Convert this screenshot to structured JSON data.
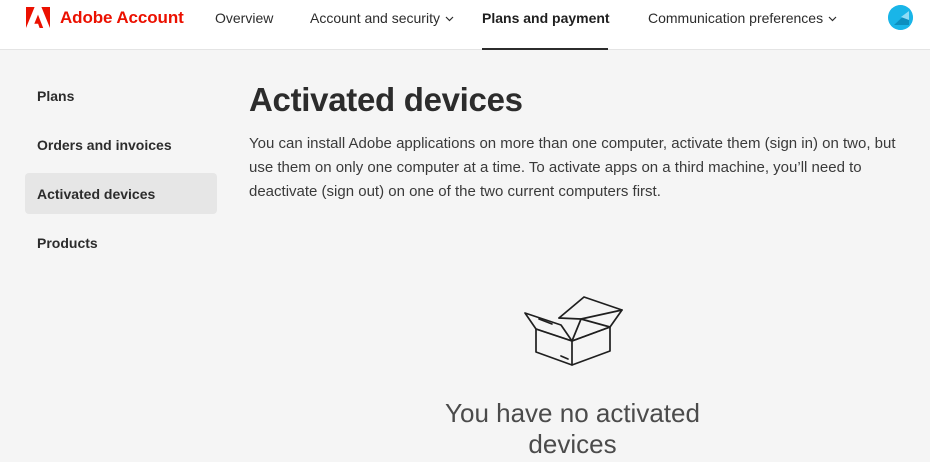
{
  "brand": {
    "name": "Adobe Account",
    "color": "#eb1000"
  },
  "nav": {
    "items": [
      {
        "label": "Overview",
        "has_menu": false
      },
      {
        "label": "Account and security",
        "has_menu": true
      },
      {
        "label": "Plans and payment",
        "has_menu": true,
        "active": true
      },
      {
        "label": "Communication preferences",
        "has_menu": true
      }
    ],
    "chevron_icon": "chevron-down-icon"
  },
  "avatar": {
    "icon": "user-avatar-icon",
    "color": "#19b5e8"
  },
  "sidebar": {
    "items": [
      {
        "label": "Plans"
      },
      {
        "label": "Orders and invoices"
      },
      {
        "label": "Activated devices",
        "active": true
      },
      {
        "label": "Products"
      }
    ]
  },
  "main": {
    "title": "Activated devices",
    "description": "You can install Adobe applications on more than one computer, activate them (sign in) on two, but use them on only one computer at a time. To activate apps on a third machine, you’ll need to deactivate (sign out) on one of the two current computers first."
  },
  "empty_state": {
    "icon": "open-box-icon",
    "message": "You have no activated devices"
  }
}
